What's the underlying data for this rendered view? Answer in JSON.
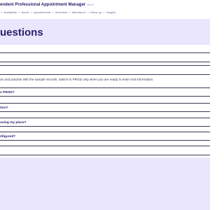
{
  "app": {
    "title": "endent Professional Appointment Manager",
    "version": "v0.0.0"
  },
  "nav": {
    "items": [
      "availability",
      "clients",
      "appointments",
      "reminders",
      "attendance",
      "follow-up",
      "insights"
    ],
    "prefix_sep": "»",
    "sep": "»"
  },
  "page": {
    "title": "uestions"
  },
  "intro": {
    "text": "on and practise with the sample records. Switch to PROD only when you are ready to enter real information."
  },
  "faq": {
    "questions": [
      "s PROD?",
      "tion?",
      "using my place?",
      "nfigured?"
    ]
  }
}
